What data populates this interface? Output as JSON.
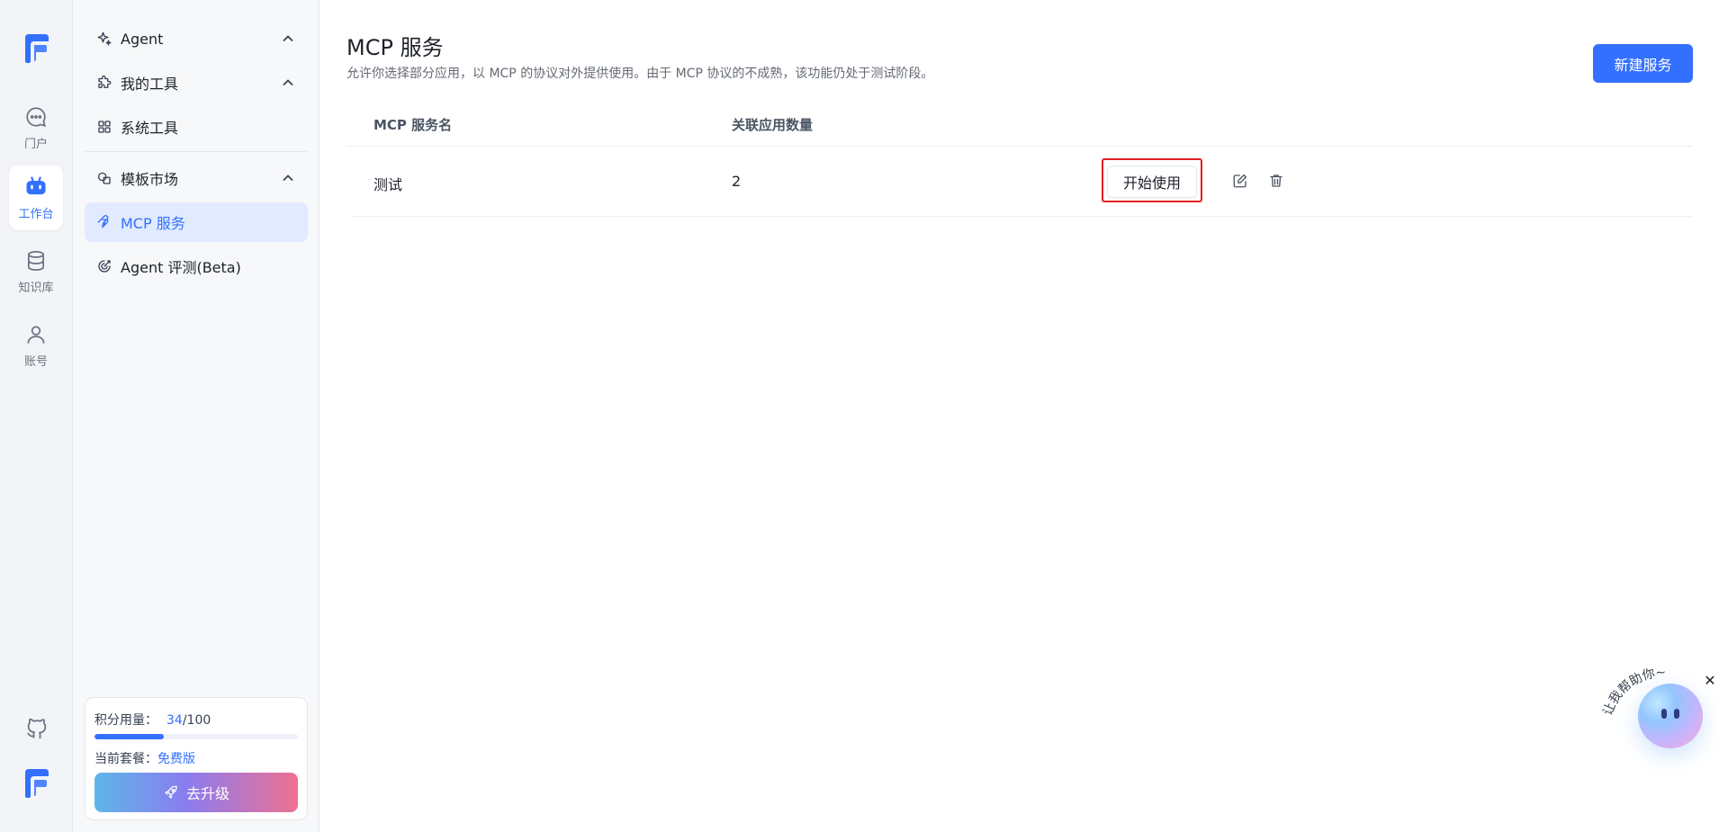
{
  "rail": {
    "items": [
      {
        "label": "门户",
        "icon": "chat-icon"
      },
      {
        "label": "工作台",
        "icon": "robot-icon",
        "active": true
      },
      {
        "label": "知识库",
        "icon": "database-icon"
      },
      {
        "label": "账号",
        "icon": "user-icon"
      }
    ]
  },
  "sidebar": {
    "items": [
      {
        "label": "Agent",
        "icon": "sparkle-icon",
        "expandable": true
      },
      {
        "label": "我的工具",
        "icon": "puzzle-icon",
        "expandable": true
      },
      {
        "label": "系统工具",
        "icon": "grid-icon"
      },
      {
        "label": "模板市场",
        "icon": "shapes-icon",
        "expandable": true
      },
      {
        "label": "MCP 服务",
        "icon": "mcp-icon",
        "active": true
      },
      {
        "label": "Agent 评测(Beta)",
        "icon": "target-icon"
      }
    ],
    "quota": {
      "label": "积分用量：",
      "used": "34",
      "total": "/100",
      "progress": 0.34,
      "plan_label": "当前套餐：",
      "plan_value": "免费版",
      "upgrade_label": "去升级"
    }
  },
  "main": {
    "title": "MCP 服务",
    "subtitle": "允许你选择部分应用，以 MCP 的协议对外提供使用。由于 MCP 协议的不成熟，该功能仍处于测试阶段。",
    "new_button": "新建服务",
    "table": {
      "columns": [
        "MCP 服务名",
        "关联应用数量"
      ],
      "rows": [
        {
          "name": "测试",
          "count": "2",
          "action": "开始使用"
        }
      ]
    }
  },
  "assistant": {
    "greeting": "hi，让我帮助你~",
    "close": "✕"
  },
  "colors": {
    "accent": "#3370ff",
    "highlight_border": "#e11d20"
  }
}
